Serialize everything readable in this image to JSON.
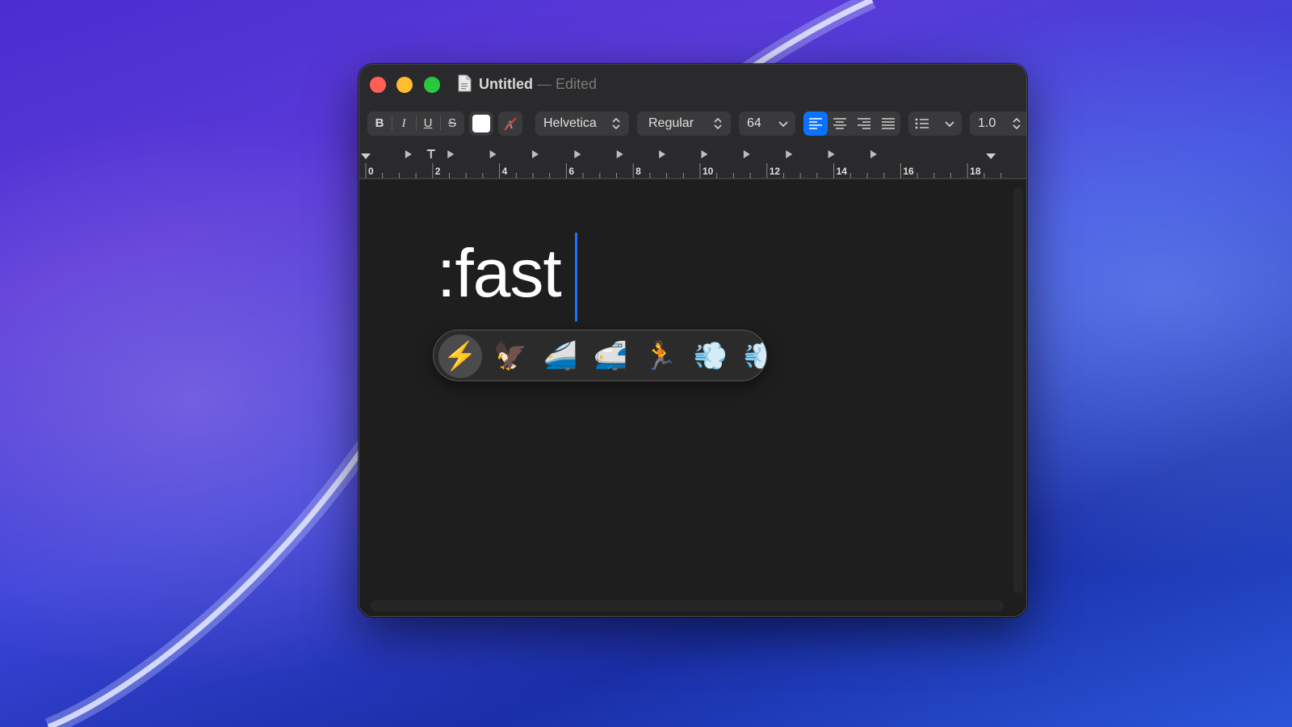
{
  "window": {
    "title": "Untitled",
    "separator": "—",
    "status": "Edited"
  },
  "toolbar": {
    "bold_label": "B",
    "italic_label": "I",
    "underline_label": "U",
    "strike_label": "S",
    "text_color": "#ffffff",
    "font_family": "Helvetica",
    "font_style": "Regular",
    "font_size": "64",
    "alignment_selected": "left",
    "line_spacing": "1.0"
  },
  "ruler": {
    "labels": [
      "0",
      "2",
      "4",
      "6",
      "8",
      "10",
      "12",
      "14",
      "16",
      "18"
    ]
  },
  "document": {
    "text": ":fast"
  },
  "emoji_picker": {
    "selected_index": 0,
    "items": [
      {
        "glyph": "⚡",
        "name": "high-voltage"
      },
      {
        "glyph": "🦅",
        "name": "eagle"
      },
      {
        "glyph": "🚄",
        "name": "high-speed-train"
      },
      {
        "glyph": "🚅",
        "name": "bullet-train"
      },
      {
        "glyph": "🏃",
        "name": "person-running"
      },
      {
        "glyph": "💨",
        "name": "dashing-away"
      },
      {
        "glyph": "💨",
        "name": "partial-next"
      }
    ]
  },
  "colors": {
    "accent": "#0a72ff",
    "close": "#ff5f57",
    "minimize": "#febc2e",
    "maximize": "#28c840"
  }
}
